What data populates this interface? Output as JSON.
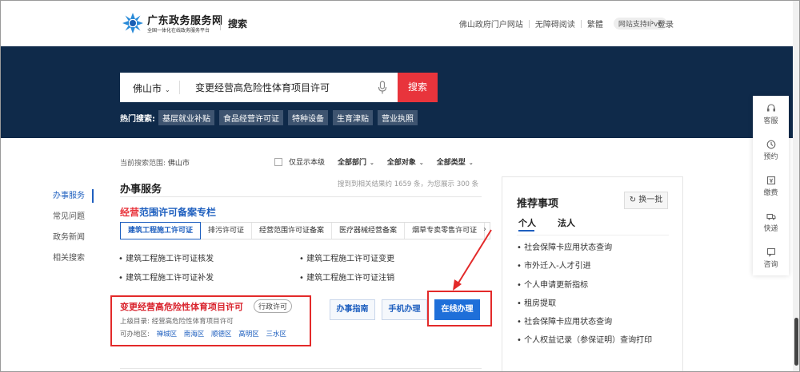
{
  "header": {
    "site_title": "广东政务服务网",
    "site_subtitle": "全国一体化在线政务服务平台",
    "section": "搜索",
    "nav": [
      "佛山政府门户网站",
      "无障碍阅读",
      "繁體"
    ],
    "ipv6": "网站支持IPv6",
    "login": "登录"
  },
  "search": {
    "city": "佛山市",
    "query": "变更经营高危险性体育项目许可",
    "button": "搜索",
    "hot_label": "热门搜索:",
    "hot_tags": [
      "基层就业补贴",
      "食品经营许可证",
      "特种设备",
      "生育津贴",
      "营业执照"
    ]
  },
  "sidenav": {
    "items": [
      "办事服务",
      "常见问题",
      "政务新闻",
      "相关搜索"
    ]
  },
  "filters": {
    "scope_label": "当前搜索范围:",
    "scope_value": "佛山市",
    "local_only": "仅显示本级",
    "dept": "全部部门",
    "target": "全部对象",
    "type": "全部类型"
  },
  "results": {
    "section_title": "办事服务",
    "count_text": "搜到到相关结果约 1659 条，为您展示 300 条",
    "topic_red": "经营",
    "topic_rest": "范围许可备案专栏",
    "tabs": [
      "建筑工程施工许可证",
      "排污许可证",
      "经营范围许可证备案",
      "医疗器械经营备案",
      "烟草专卖零售许可证"
    ],
    "topic_items": [
      "建筑工程施工许可证核发",
      "建筑工程施工许可证变更",
      "建筑工程施工许可证补发",
      "建筑工程施工许可证注销"
    ],
    "item": {
      "title": "变更经营高危险性体育项目许可",
      "badge": "行政许可",
      "parent_label": "上级目录:",
      "parent_value": "经营高危险性体育项目许可",
      "areas_label": "可办地区:",
      "areas": [
        "禅城区",
        "南海区",
        "顺德区",
        "高明区",
        "三水区"
      ],
      "btn_guide": "办事指南",
      "btn_mobile": "手机办理",
      "btn_online": "在线办理"
    }
  },
  "recommend": {
    "title": "推荐事项",
    "refresh": "换一批",
    "tabs": [
      "个人",
      "法人"
    ],
    "items": [
      "社会保障卡应用状态查询",
      "市外迁入-人才引进",
      "个人申请更新指标",
      "租房提取",
      "社会保障卡应用状态查询",
      "个人权益记录（参保证明）查询打印"
    ]
  },
  "floatbar": [
    "客服",
    "预约",
    "缴费",
    "快递",
    "咨询"
  ],
  "colors": {
    "banner": "#0f2a4a",
    "accent_red": "#e8343c",
    "link_blue": "#1e5fbf"
  }
}
